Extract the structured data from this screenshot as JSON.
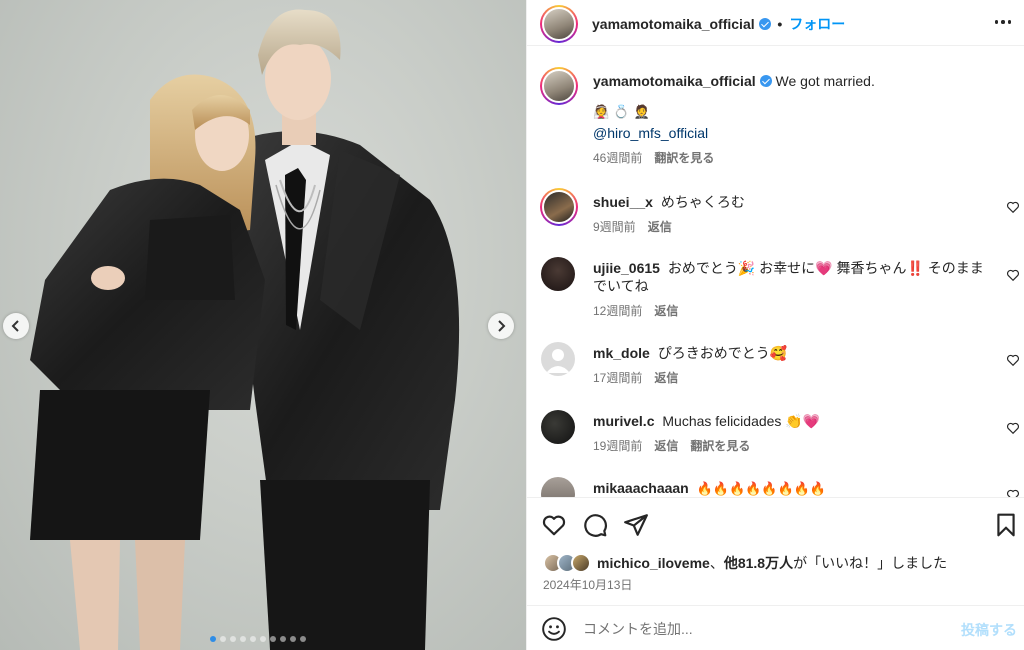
{
  "header": {
    "username": "yamamotomaika_official",
    "separator": "•",
    "follow_label": "フォロー",
    "more_icon": "more-horizontal-icon"
  },
  "caption": {
    "username": "yamamotomaika_official",
    "text": "We got married.",
    "emojis": "👰 💍 🤵",
    "mention": "@hiro_mfs_official",
    "time": "46週間前",
    "translate_label": "翻訳を見る"
  },
  "comments": [
    {
      "username": "shuei__x",
      "text": "めちゃくろむ",
      "time": "9週間前",
      "reply_label": "返信",
      "translate_label": ""
    },
    {
      "username": "ujiie_0615",
      "text": "おめでとう🎉 お幸せに💗 舞香ちゃん‼️ そのままでいてね",
      "time": "12週間前",
      "reply_label": "返信",
      "translate_label": ""
    },
    {
      "username": "mk_dole",
      "text": "ぴろきおめでとう🥰",
      "time": "17週間前",
      "reply_label": "返信",
      "translate_label": ""
    },
    {
      "username": "murivel.c",
      "text": "Muchas felicidades 👏💗",
      "time": "19週間前",
      "reply_label": "返信",
      "translate_label": "翻訳を見る"
    },
    {
      "username": "mikaaachaaan",
      "text": "🔥🔥🔥🔥🔥🔥🔥🔥",
      "time": "",
      "reply_label": "",
      "translate_label": ""
    }
  ],
  "likes": {
    "first_user": "michico_iloveme",
    "joiner": "、",
    "others": "他81.8万人",
    "suffix": "が「いいね！」しました"
  },
  "date": "2024年10月13日",
  "comment_box": {
    "placeholder": "コメントを追加...",
    "post_label": "投稿する"
  },
  "carousel": {
    "total": 10,
    "active_index": 0
  },
  "colors": {
    "accent": "#0095f6",
    "verified": "#3897f0",
    "muted": "#737373",
    "dot_active": "#2e8de6"
  }
}
